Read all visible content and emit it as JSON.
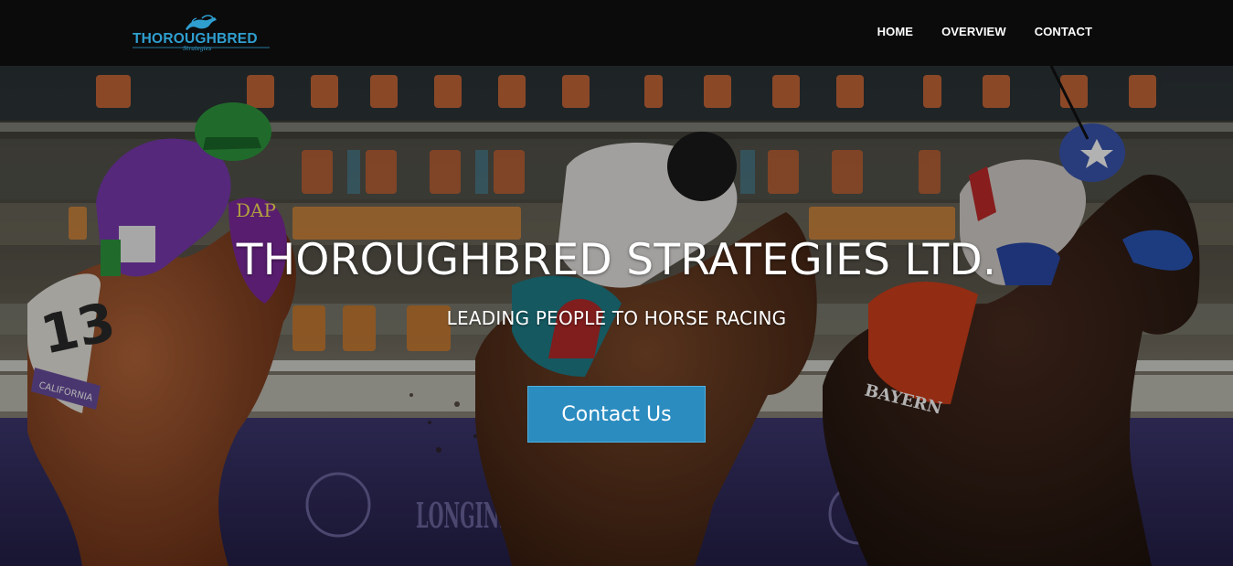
{
  "brand": {
    "logo_text": "THOROUGHBRED",
    "logo_sub": "Strategies",
    "color": "#2f9fd0"
  },
  "nav": {
    "items": [
      {
        "label": "HOME"
      },
      {
        "label": "OVERVIEW"
      },
      {
        "label": "CONTACT"
      }
    ]
  },
  "hero": {
    "title": "THOROUGHBRED STRATEGIES LTD.",
    "subtitle": "LEADING PEOPLE TO HORSE RACING",
    "cta_label": "Contact Us",
    "cta_color": "#2b8cc0",
    "photo": {
      "saddle_cloth_left": "CALIFORNIA",
      "saddle_cloth_right": "BAYERN",
      "cap_initials": "DAP",
      "saddle_number": "13",
      "rail_banner": "LONGINES"
    }
  }
}
